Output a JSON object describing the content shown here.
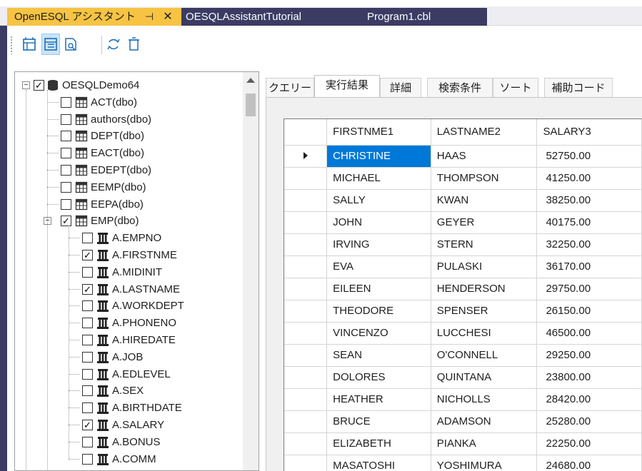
{
  "tabs": {
    "active": {
      "label": "OpenESQL アシスタント",
      "pin": "⊣",
      "close": "✕"
    },
    "tutorial": {
      "label": "OESQLAssistantTutorial"
    },
    "program": {
      "label": "Program1.cbl"
    }
  },
  "toolbar": {
    "buttons": [
      "query-icon",
      "result-icon",
      "preview-icon",
      "refresh-icon",
      "clear-icon"
    ]
  },
  "tree": {
    "root": {
      "label": "OESQLDemo64",
      "checked": true,
      "expanded": true
    },
    "tables": [
      {
        "label": "ACT(dbo)",
        "checked": false
      },
      {
        "label": "authors(dbo)",
        "checked": false
      },
      {
        "label": "DEPT(dbo)",
        "checked": false
      },
      {
        "label": "EACT(dbo)",
        "checked": false
      },
      {
        "label": "EDEPT(dbo)",
        "checked": false
      },
      {
        "label": "EEMP(dbo)",
        "checked": false
      },
      {
        "label": "EEPA(dbo)",
        "checked": false
      },
      {
        "label": "EMP(dbo)",
        "checked": true,
        "expanded": true
      }
    ],
    "columns": [
      {
        "label": "A.EMPNO",
        "checked": false
      },
      {
        "label": "A.FIRSTNME",
        "checked": true
      },
      {
        "label": "A.MIDINIT",
        "checked": false
      },
      {
        "label": "A.LASTNAME",
        "checked": true
      },
      {
        "label": "A.WORKDEPT",
        "checked": false
      },
      {
        "label": "A.PHONENO",
        "checked": false
      },
      {
        "label": "A.HIREDATE",
        "checked": false
      },
      {
        "label": "A.JOB",
        "checked": false
      },
      {
        "label": "A.EDLEVEL",
        "checked": false
      },
      {
        "label": "A.SEX",
        "checked": false
      },
      {
        "label": "A.BIRTHDATE",
        "checked": false
      },
      {
        "label": "A.SALARY",
        "checked": true
      },
      {
        "label": "A.BONUS",
        "checked": false
      },
      {
        "label": "A.COMM",
        "checked": false
      }
    ]
  },
  "subtabs": [
    {
      "label": "クエリー",
      "active": false
    },
    {
      "label": "実行結果",
      "active": true
    },
    {
      "label": "詳細",
      "active": false
    },
    {
      "label": "検索条件",
      "active": false
    },
    {
      "label": "ソート",
      "active": false
    },
    {
      "label": "補助コード",
      "active": false
    }
  ],
  "grid": {
    "headers": [
      "FIRSTNME1",
      "LASTNAME2",
      "SALARY3"
    ],
    "rows": [
      [
        "CHRISTINE",
        "HAAS",
        "52750.00"
      ],
      [
        "MICHAEL",
        "THOMPSON",
        "41250.00"
      ],
      [
        "SALLY",
        "KWAN",
        "38250.00"
      ],
      [
        "JOHN",
        "GEYER",
        "40175.00"
      ],
      [
        "IRVING",
        "STERN",
        "32250.00"
      ],
      [
        "EVA",
        "PULASKI",
        "36170.00"
      ],
      [
        "EILEEN",
        "HENDERSON",
        "29750.00"
      ],
      [
        "THEODORE",
        "SPENSER",
        "26150.00"
      ],
      [
        "VINCENZO",
        "LUCCHESI",
        "46500.00"
      ],
      [
        "SEAN",
        "O'CONNELL",
        "29250.00"
      ],
      [
        "DOLORES",
        "QUINTANA",
        "23800.00"
      ],
      [
        "HEATHER",
        "NICHOLLS",
        "28420.00"
      ],
      [
        "BRUCE",
        "ADAMSON",
        "25280.00"
      ],
      [
        "ELIZABETH",
        "PIANKA",
        "22250.00"
      ],
      [
        "MASATOSHI",
        "YOSHIMURA",
        "24680.00"
      ]
    ],
    "selected_row": 0
  },
  "colors": {
    "active_tab": "#f6c343",
    "inactive_tab": "#3b3b64",
    "selection": "#0078d7"
  }
}
